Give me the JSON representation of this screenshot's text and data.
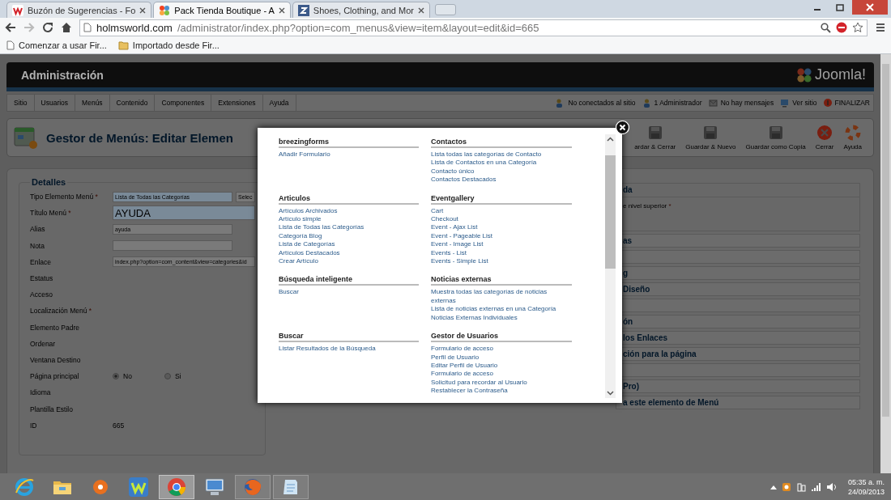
{
  "browser": {
    "tabs": [
      {
        "title": "Buzón de Sugerencias - Fo",
        "selected": false
      },
      {
        "title": "Pack Tienda Boutique - A",
        "selected": true
      },
      {
        "title": "Shoes, Clothing, and Mor",
        "selected": false
      }
    ],
    "url": {
      "host": "holmsworld.com",
      "path": "/administrator/index.php?option=com_menus&view=item&layout=edit&id=665"
    },
    "bookmarks": [
      {
        "label": "Comenzar a usar Fir...",
        "kind": "page"
      },
      {
        "label": "Importado desde Fir...",
        "kind": "folder"
      }
    ]
  },
  "admin": {
    "title": "Administración",
    "logo": "Joomla!",
    "menu": [
      "Sitio",
      "Usuarios",
      "Menús",
      "Contenido",
      "Componentes",
      "Extensiones",
      "Ayuda"
    ],
    "status": [
      {
        "label": "No conectados al sitio",
        "kind": "users"
      },
      {
        "label": "1 Administrador",
        "kind": "user"
      },
      {
        "label": "No hay mensajes",
        "kind": "mail"
      },
      {
        "label": "Ver sitio",
        "kind": "site"
      },
      {
        "label": "FINALIZAR",
        "kind": "logout"
      }
    ]
  },
  "toolbar": {
    "title": "Gestor de Menús: Editar Elemen",
    "buttons": [
      {
        "label": "ardar & Cerrar",
        "kind": "save"
      },
      {
        "label": "Guardar & Nuevo",
        "kind": "save-new"
      },
      {
        "label": "Guardar como Copia",
        "kind": "copy"
      },
      {
        "label": "Cerrar",
        "kind": "close"
      },
      {
        "label": "Ayuda",
        "kind": "help"
      }
    ]
  },
  "form": {
    "legend": "Detalles",
    "fields": [
      {
        "label": "Tipo Elemento Menú",
        "mark": "*",
        "kind": "select",
        "value": "Lista de Todas las Categorías",
        "button": "Selec"
      },
      {
        "label": "Título Menú",
        "mark": "*",
        "kind": "big",
        "value": "AYUDA"
      },
      {
        "label": "Alias",
        "kind": "input",
        "value": "ayuda"
      },
      {
        "label": "Nota",
        "kind": "input"
      },
      {
        "label": "Enlace",
        "kind": "wide",
        "value": "index.php?option=com_content&view=categories&id"
      },
      {
        "label": "Estatus",
        "kind": "none"
      },
      {
        "label": "Acceso",
        "kind": "none"
      },
      {
        "label": "Localización Menú",
        "mark": "*",
        "kind": "none"
      },
      {
        "label": "Elemento Padre",
        "kind": "none"
      },
      {
        "label": "Ordenar",
        "kind": "none"
      },
      {
        "label": "Ventana Destino",
        "kind": "none"
      },
      {
        "label": "Página principal",
        "kind": "radio",
        "options": [
          {
            "label": "No",
            "selected": true
          },
          {
            "label": "Si",
            "selected": false
          }
        ]
      },
      {
        "label": "Idioma",
        "kind": "none"
      },
      {
        "label": "Plantilla Estilo",
        "kind": "none"
      },
      {
        "label": "ID",
        "kind": "text",
        "value": "665"
      }
    ]
  },
  "side": {
    "head": {
      "title": "da",
      "body": "e nivel superior",
      "mark": "*"
    },
    "sections": [
      {
        "kind": "titled",
        "title": "as"
      },
      {
        "kind": "blank"
      },
      {
        "kind": "titled",
        "title": "g"
      },
      {
        "kind": "titled",
        "title": "Diseño"
      },
      {
        "kind": "blank"
      },
      {
        "kind": "titled",
        "title": "ón"
      },
      {
        "kind": "titled",
        "title": "los Enlaces"
      },
      {
        "kind": "titled",
        "title": "ción para la página"
      },
      {
        "kind": "blank"
      },
      {
        "kind": "titled",
        "title": "Pro)"
      },
      {
        "kind": "titled",
        "title": "a este elemento de Menú"
      }
    ]
  },
  "modal": {
    "groups": [
      {
        "heading": "breezingforms",
        "links": [
          "Añadir Formulario"
        ]
      },
      {
        "heading": "Contactos",
        "links": [
          "Lista todas las categorías de Contacto",
          "Lista de Contactos en una Categoría",
          "Contacto único",
          "Contactos Destacados"
        ]
      },
      {
        "heading": "Articulos",
        "links": [
          "Artículos Archivados",
          "Artículo simple",
          "Lista de Todas las Categorías",
          "Categoría Blog",
          "Lista de Categorías",
          "Artículos Destacados",
          "Crear Artículo"
        ]
      },
      {
        "heading": "Eventgallery",
        "links": [
          "Cart",
          "Checkout",
          "Event - Ajax List",
          "Event - Pageable List",
          "Event - Image List",
          "Events - List",
          "Events - Simple List"
        ]
      },
      {
        "heading": "Búsqueda inteligente",
        "links": [
          "Buscar"
        ]
      },
      {
        "heading": "Noticias externas",
        "links": [
          "Muestra todas las categorías de noticias externas",
          "Lista de noticias externas en una Categoría",
          "Noticias Externas Individuales"
        ]
      },
      {
        "heading": "Buscar",
        "links": [
          "Listar Resultados de la Búsqueda"
        ]
      },
      {
        "heading": "Gestor de Usuarios",
        "links": [
          "Formulario de acceso",
          "Perfil de Usuario",
          "Editar Perfil de Usuario",
          "Formulario de acceso",
          "Solicitud para recordar al Usuario",
          "Restablecer la Contraseña"
        ]
      }
    ]
  },
  "taskbar": {
    "apps": [
      {
        "kind": "ie",
        "selected": false,
        "running": false
      },
      {
        "kind": "folder",
        "selected": false,
        "running": false
      },
      {
        "kind": "media",
        "selected": false,
        "running": false
      },
      {
        "kind": "w",
        "selected": false,
        "running": false
      },
      {
        "kind": "chrome",
        "selected": true,
        "running": true
      },
      {
        "kind": "monitor",
        "selected": false,
        "running": false
      },
      {
        "kind": "firefox",
        "selected": false,
        "running": true
      },
      {
        "kind": "notepad",
        "selected": false,
        "running": true
      }
    ],
    "time": "05:35 a. m.",
    "date": "24/09/2013"
  }
}
